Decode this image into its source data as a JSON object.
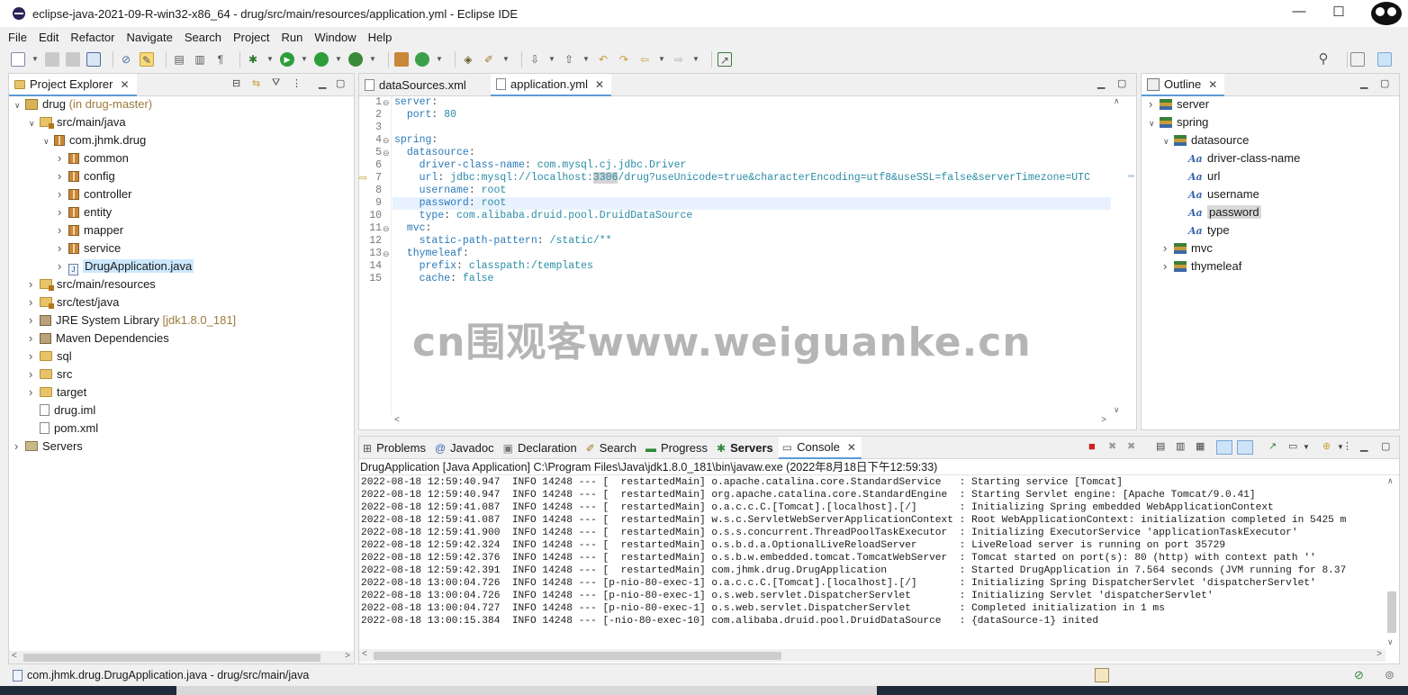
{
  "window": {
    "title": "eclipse-java-2021-09-R-win32-x86_64 - drug/src/main/resources/application.yml - Eclipse IDE"
  },
  "menu": [
    "File",
    "Edit",
    "Refactor",
    "Navigate",
    "Search",
    "Project",
    "Run",
    "Window",
    "Help"
  ],
  "project_explorer": {
    "tab_label": "Project Explorer",
    "tree": [
      {
        "label": "drug",
        "deco": " (in drug-master)",
        "level": 0,
        "icon": "proj",
        "expanded": true
      },
      {
        "label": "src/main/java",
        "level": 1,
        "icon": "srcf",
        "expanded": true
      },
      {
        "label": "com.jhmk.drug",
        "level": 2,
        "icon": "pkg",
        "expanded": true
      },
      {
        "label": "common",
        "level": 3,
        "icon": "pkg",
        "expanded": false
      },
      {
        "label": "config",
        "level": 3,
        "icon": "pkg",
        "expanded": false
      },
      {
        "label": "controller",
        "level": 3,
        "icon": "pkg",
        "expanded": false
      },
      {
        "label": "entity",
        "level": 3,
        "icon": "pkg",
        "expanded": false
      },
      {
        "label": "mapper",
        "level": 3,
        "icon": "pkg",
        "expanded": false
      },
      {
        "label": "service",
        "level": 3,
        "icon": "pkg",
        "expanded": false
      },
      {
        "label": "DrugApplication.java",
        "level": 3,
        "icon": "jfile",
        "expanded": false,
        "selected": true
      },
      {
        "label": "src/main/resources",
        "level": 1,
        "icon": "srcf",
        "expanded": false
      },
      {
        "label": "src/test/java",
        "level": 1,
        "icon": "srcf",
        "expanded": false
      },
      {
        "label": "JRE System Library",
        "deco": " [jdk1.8.0_181]",
        "level": 1,
        "icon": "jar",
        "expanded": false
      },
      {
        "label": "Maven Dependencies",
        "level": 1,
        "icon": "jar",
        "expanded": false
      },
      {
        "label": "sql",
        "level": 1,
        "icon": "fold",
        "expanded": false
      },
      {
        "label": "src",
        "level": 1,
        "icon": "fold",
        "expanded": false
      },
      {
        "label": "target",
        "level": 1,
        "icon": "fold",
        "expanded": false
      },
      {
        "label": "drug.iml",
        "level": 1,
        "icon": "xmlf",
        "leaf": true
      },
      {
        "label": "pom.xml",
        "level": 1,
        "icon": "xmlf",
        "leaf": true
      },
      {
        "label": "Servers",
        "level": 0,
        "icon": "srv",
        "expanded": false
      }
    ]
  },
  "editor": {
    "tabs": [
      {
        "label": "dataSources.xml",
        "active": false
      },
      {
        "label": "application.yml",
        "active": true
      }
    ],
    "lines": [
      {
        "n": "1",
        "fold": true,
        "indent": "",
        "key": "server",
        "val": ""
      },
      {
        "n": "2",
        "indent": "  ",
        "key": "port",
        "val": "80"
      },
      {
        "n": "3",
        "indent": "",
        "key": "",
        "val": ""
      },
      {
        "n": "4",
        "fold": true,
        "indent": "",
        "key": "spring",
        "val": ""
      },
      {
        "n": "5",
        "fold": true,
        "indent": "  ",
        "key": "datasource",
        "val": ""
      },
      {
        "n": "6",
        "indent": "    ",
        "key": "driver-class-name",
        "val": "com.mysql.cj.jdbc.Driver"
      },
      {
        "n": "7",
        "indent": "    ",
        "key": "url",
        "val_pre": "jdbc:mysql://localhost:",
        "val_hl": "3306",
        "val_post": "/drug?useUnicode=true&characterEncoding=utf8&useSSL=false&serverTimezone=UTC"
      },
      {
        "n": "8",
        "indent": "    ",
        "key": "username",
        "val": "root"
      },
      {
        "n": "9",
        "indent": "    ",
        "key": "password",
        "val": "root",
        "current": true
      },
      {
        "n": "10",
        "indent": "    ",
        "key": "type",
        "val": "com.alibaba.druid.pool.DruidDataSource"
      },
      {
        "n": "11",
        "fold": true,
        "indent": "  ",
        "key": "mvc",
        "val": ""
      },
      {
        "n": "12",
        "indent": "    ",
        "key": "static-path-pattern",
        "val": "/static/**"
      },
      {
        "n": "13",
        "fold": true,
        "indent": "  ",
        "key": "thymeleaf",
        "val": ""
      },
      {
        "n": "14",
        "indent": "    ",
        "key": "prefix",
        "val": "classpath:/templates"
      },
      {
        "n": "15",
        "indent": "    ",
        "key": "cache",
        "val": "false"
      }
    ]
  },
  "outline": {
    "tab_label": "Outline",
    "items": [
      {
        "label": "server",
        "level": 0,
        "icon": "map",
        "expanded": false
      },
      {
        "label": "spring",
        "level": 0,
        "icon": "map",
        "expanded": true
      },
      {
        "label": "datasource",
        "level": 1,
        "icon": "map",
        "expanded": true
      },
      {
        "label": "driver-class-name",
        "level": 2,
        "icon": "aa"
      },
      {
        "label": "url",
        "level": 2,
        "icon": "aa"
      },
      {
        "label": "username",
        "level": 2,
        "icon": "aa"
      },
      {
        "label": "password",
        "level": 2,
        "icon": "aa",
        "selected": true
      },
      {
        "label": "type",
        "level": 2,
        "icon": "aa"
      },
      {
        "label": "mvc",
        "level": 1,
        "icon": "map",
        "expanded": false
      },
      {
        "label": "thymeleaf",
        "level": 1,
        "icon": "map",
        "expanded": false
      }
    ]
  },
  "bottom": {
    "tabs": [
      {
        "label": "Problems",
        "icon": "problems-icon"
      },
      {
        "label": "Javadoc",
        "icon": "at-icon"
      },
      {
        "label": "Declaration",
        "icon": "declaration-icon"
      },
      {
        "label": "Search",
        "icon": "search-icon"
      },
      {
        "label": "Progress",
        "icon": "progress-icon"
      },
      {
        "label": "Servers",
        "icon": "servers-icon",
        "bold": true
      },
      {
        "label": "Console",
        "icon": "console-icon",
        "active": true
      }
    ],
    "process": "DrugApplication [Java Application] C:\\Program Files\\Java\\jdk1.8.0_181\\bin\\javaw.exe  (2022年8月18日下午12:59:33)",
    "console_lines": [
      "2022-08-18 12:59:40.947  INFO 14248 --- [  restartedMain] o.apache.catalina.core.StandardService   : Starting service [Tomcat]",
      "2022-08-18 12:59:40.947  INFO 14248 --- [  restartedMain] org.apache.catalina.core.StandardEngine  : Starting Servlet engine: [Apache Tomcat/9.0.41]",
      "2022-08-18 12:59:41.087  INFO 14248 --- [  restartedMain] o.a.c.c.C.[Tomcat].[localhost].[/]       : Initializing Spring embedded WebApplicationContext",
      "2022-08-18 12:59:41.087  INFO 14248 --- [  restartedMain] w.s.c.ServletWebServerApplicationContext : Root WebApplicationContext: initialization completed in 5425 m",
      "2022-08-18 12:59:41.900  INFO 14248 --- [  restartedMain] o.s.s.concurrent.ThreadPoolTaskExecutor  : Initializing ExecutorService 'applicationTaskExecutor'",
      "2022-08-18 12:59:42.324  INFO 14248 --- [  restartedMain] o.s.b.d.a.OptionalLiveReloadServer       : LiveReload server is running on port 35729",
      "2022-08-18 12:59:42.376  INFO 14248 --- [  restartedMain] o.s.b.w.embedded.tomcat.TomcatWebServer  : Tomcat started on port(s): 80 (http) with context path ''",
      "2022-08-18 12:59:42.391  INFO 14248 --- [  restartedMain] com.jhmk.drug.DrugApplication            : Started DrugApplication in 7.564 seconds (JVM running for 8.37",
      "2022-08-18 13:00:04.726  INFO 14248 --- [p-nio-80-exec-1] o.a.c.c.C.[Tomcat].[localhost].[/]       : Initializing Spring DispatcherServlet 'dispatcherServlet'",
      "2022-08-18 13:00:04.726  INFO 14248 --- [p-nio-80-exec-1] o.s.web.servlet.DispatcherServlet        : Initializing Servlet 'dispatcherServlet'",
      "2022-08-18 13:00:04.727  INFO 14248 --- [p-nio-80-exec-1] o.s.web.servlet.DispatcherServlet        : Completed initialization in 1 ms",
      "2022-08-18 13:00:15.384  INFO 14248 --- [-nio-80-exec-10] com.alibaba.druid.pool.DruidDataSource   : {dataSource-1} inited"
    ]
  },
  "watermark": "cn围观客www.weiguanke.cn",
  "statusbar": {
    "text": "com.jhmk.drug.DrugApplication.java - drug/src/main/java"
  },
  "colors": {
    "yaml_key": "#2b7ab8",
    "yaml_value": "#2a8ca5",
    "selection": "#cce8ff",
    "active_tab_underline": "#5b9bd5"
  }
}
